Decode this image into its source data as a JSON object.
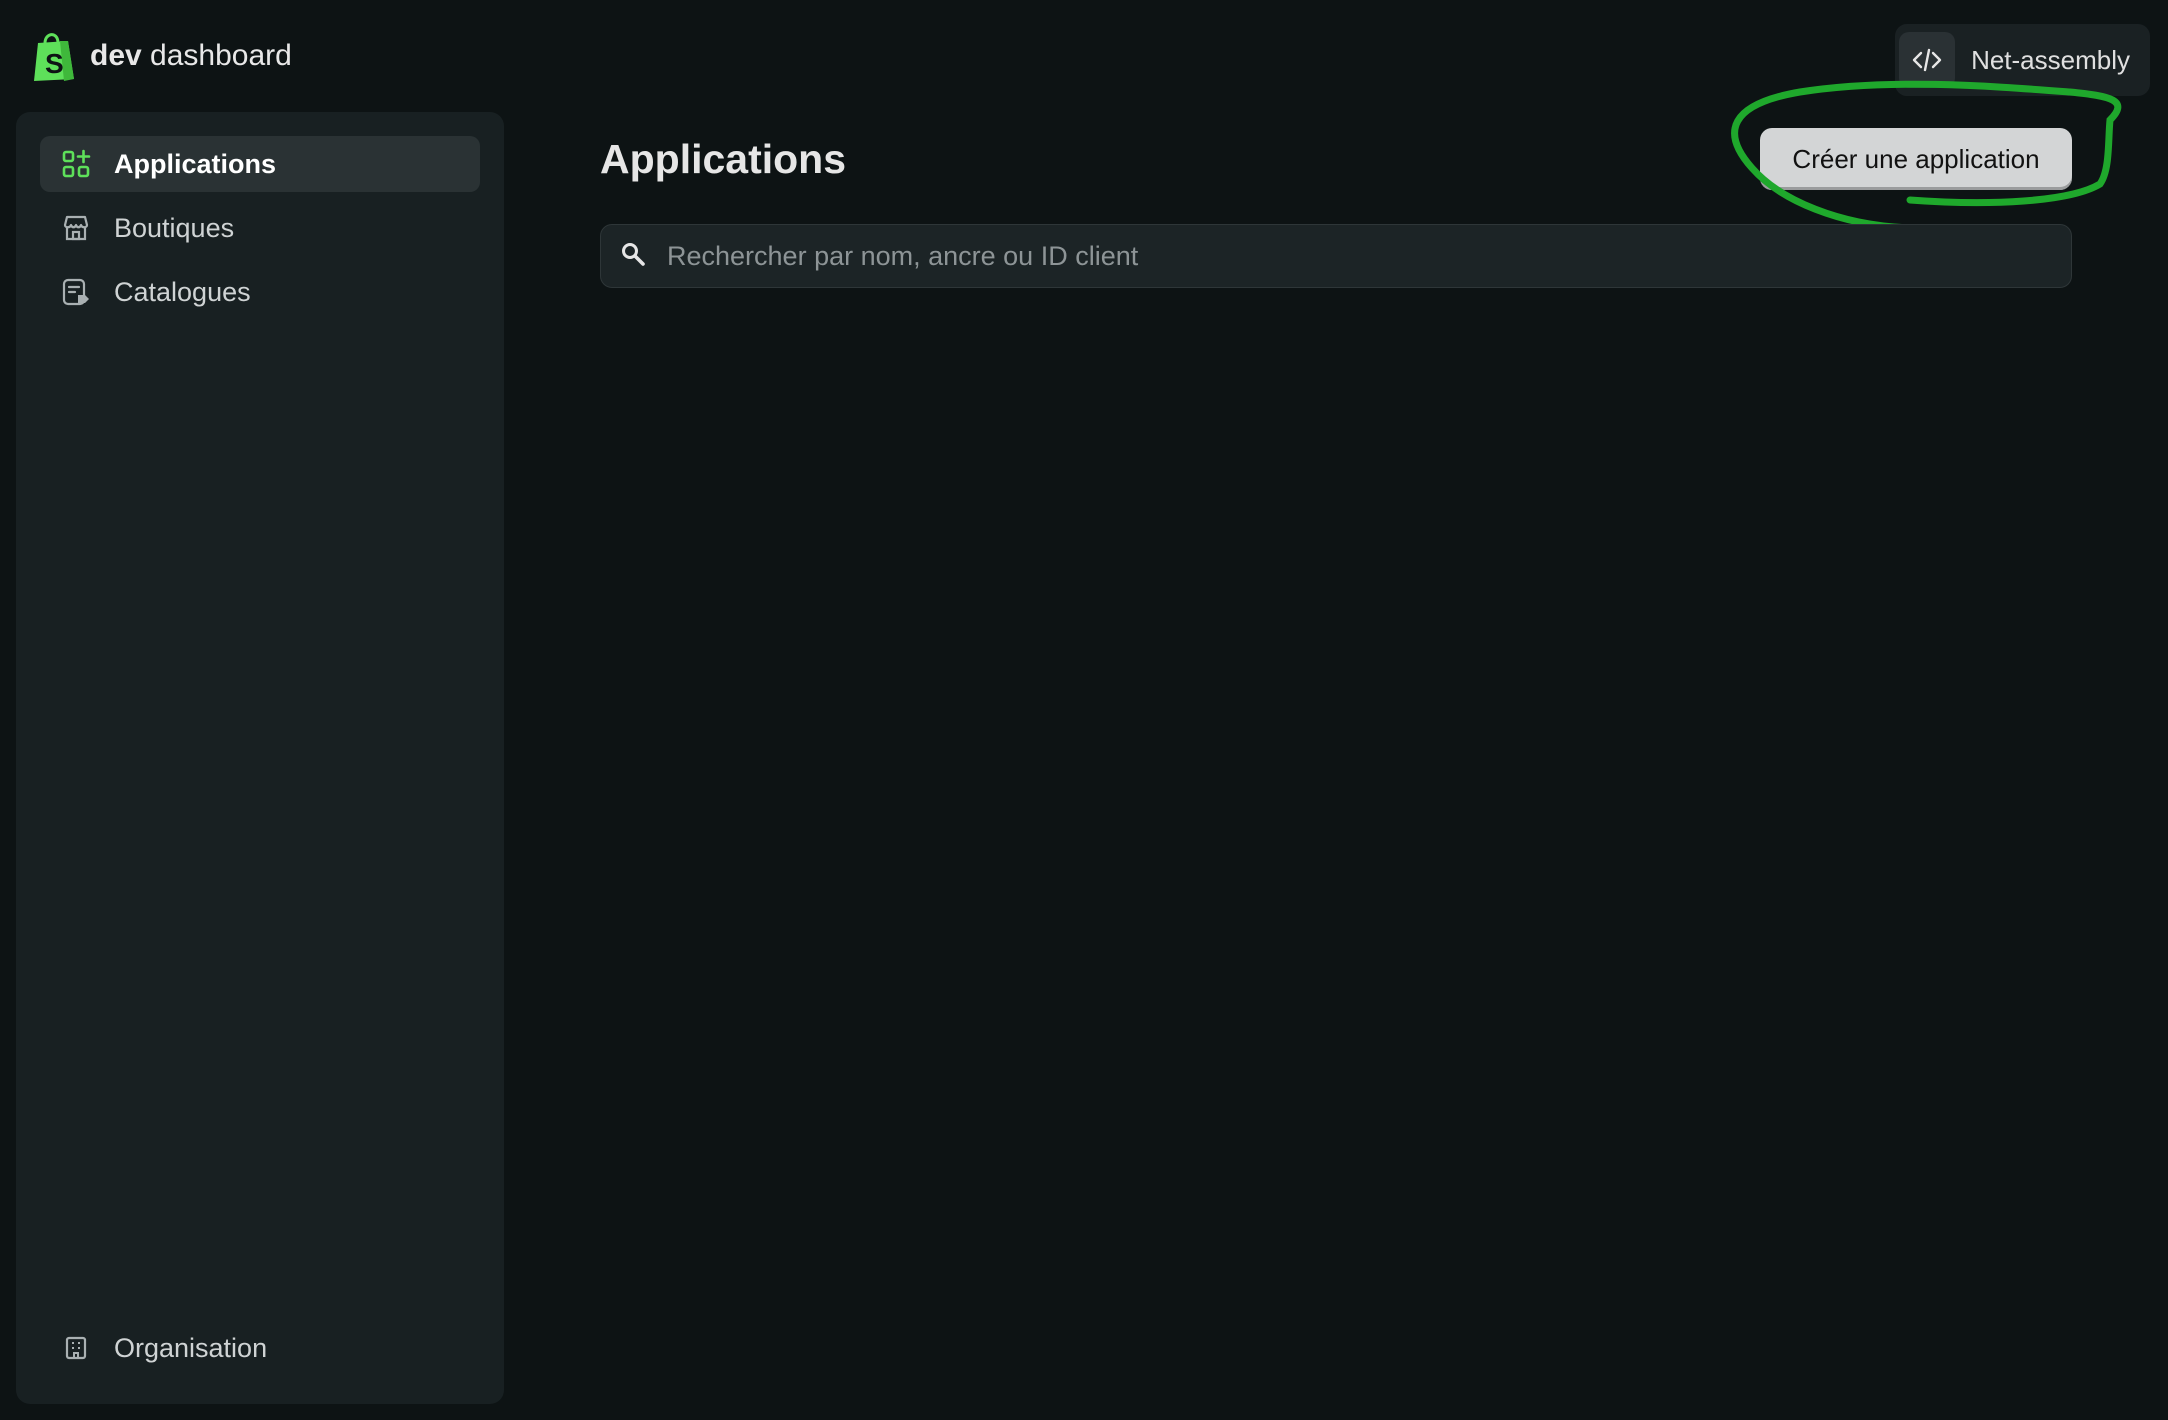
{
  "header": {
    "brand_bold": "dev",
    "brand_rest": " dashboard",
    "logo_icon": "shopify-bag-icon",
    "org_icon": "code-icon",
    "org_name": "Net-assembly"
  },
  "sidebar": {
    "items": [
      {
        "label": "Applications",
        "icon": "apps-grid-icon",
        "active": true
      },
      {
        "label": "Boutiques",
        "icon": "store-icon",
        "active": false
      },
      {
        "label": "Catalogues",
        "icon": "catalog-icon",
        "active": false
      }
    ],
    "bottom_item": {
      "label": "Organisation",
      "icon": "building-icon"
    }
  },
  "main": {
    "title": "Applications",
    "create_button": "Créer une application",
    "search_placeholder": "Rechercher par nom, ancre ou ID client"
  },
  "colors": {
    "background": "#0d1314",
    "sidebar": "#182022",
    "accent_green": "#5ee05a",
    "annotation_green": "#1fa82c"
  }
}
